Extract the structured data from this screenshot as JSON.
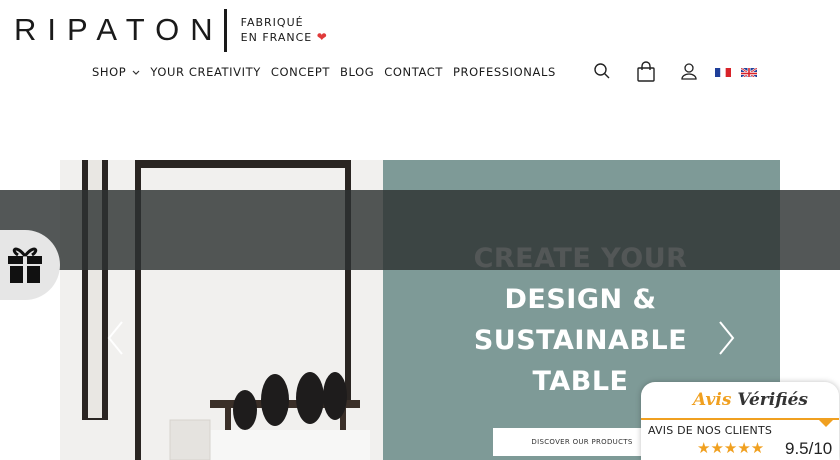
{
  "brand": {
    "logo_text": "RIPATON",
    "tagline_line1": "FABRIQUÉ",
    "tagline_line2": "EN FRANCE"
  },
  "nav": {
    "items": [
      {
        "label": "SHOP",
        "has_dropdown": true
      },
      {
        "label": "YOUR CREATIVITY"
      },
      {
        "label": "CONCEPT"
      },
      {
        "label": "BLOG"
      },
      {
        "label": "CONTACT"
      },
      {
        "label": "PROFESSIONALS"
      }
    ],
    "icons": [
      "search-icon",
      "shopping-bag-icon",
      "user-icon"
    ],
    "flags": [
      "flag-fr-icon",
      "flag-uk-icon"
    ]
  },
  "hero": {
    "title_lines": [
      "CREATE YOUR",
      "DESIGN &",
      "SUSTAINABLE",
      "TABLE"
    ],
    "cta": "DISCOVER OUR PRODUCTS",
    "panel_color": "#7e9a97"
  },
  "reviews": {
    "logo_part1": "Avis",
    "logo_part2": "Vérifiés",
    "caption": "AVIS DE NOS CLIENTS",
    "stars": "★★★★★",
    "rating_fraction": 0.95,
    "score": "9.5/10",
    "accent_color": "#f0a020"
  },
  "gift": {
    "icon": "gift-icon",
    "color": "#111111"
  }
}
